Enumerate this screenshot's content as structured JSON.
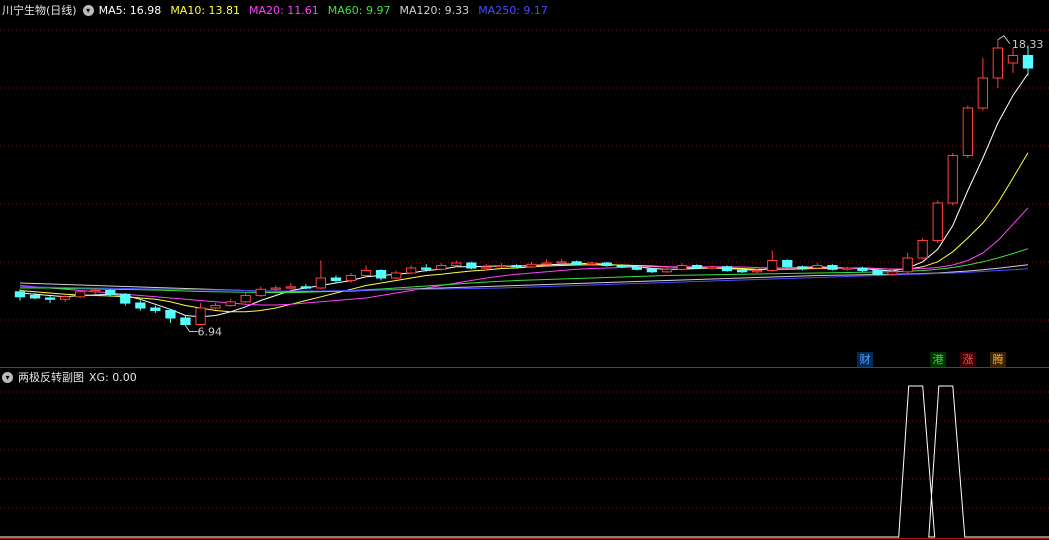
{
  "header": {
    "stock_title": "川宁生物(日线)",
    "ma_items": [
      {
        "label": "MA5: 16.98",
        "color": "#ffffff"
      },
      {
        "label": "MA10: 13.81",
        "color": "#ffff40"
      },
      {
        "label": "MA20: 11.61",
        "color": "#ff40ff"
      },
      {
        "label": "MA60: 9.97",
        "color": "#40e040"
      },
      {
        "label": "MA120: 9.33",
        "color": "#d0d0d0"
      },
      {
        "label": "MA250: 9.17",
        "color": "#4a4aff"
      }
    ]
  },
  "sub_header": {
    "title": "两极反转副图",
    "xg_label": "XG: 0.00"
  },
  "badges": [
    {
      "text": "财",
      "color": "#5aa0ff",
      "bg": "#002a55"
    },
    {
      "text": "港",
      "color": "#30e030",
      "bg": "#003300"
    },
    {
      "text": "涨",
      "color": "#ff5050",
      "bg": "#3a0000"
    },
    {
      "text": "腾",
      "color": "#ffaa30",
      "bg": "#3a2200"
    }
  ],
  "colors": {
    "up": "#ff4040",
    "down": "#54ffff",
    "grid": "#8a1010",
    "divider": "#b01818"
  },
  "chart_data": {
    "type": "candlestick",
    "price_range": [
      6.0,
      19.2
    ],
    "annotations": {
      "high_label": "18.33",
      "low_label": "6.94"
    },
    "candles": [
      {
        "o": 8.25,
        "c": 8.05,
        "h": 8.35,
        "l": 7.9
      },
      {
        "o": 8.1,
        "c": 8.0,
        "h": 8.2,
        "l": 7.95
      },
      {
        "o": 8.0,
        "c": 7.95,
        "h": 8.1,
        "l": 7.8
      },
      {
        "o": 7.95,
        "c": 8.05,
        "h": 8.1,
        "l": 7.85
      },
      {
        "o": 8.05,
        "c": 8.25,
        "h": 8.3,
        "l": 8.0
      },
      {
        "o": 8.25,
        "c": 8.3,
        "h": 8.4,
        "l": 8.15
      },
      {
        "o": 8.3,
        "c": 8.15,
        "h": 8.35,
        "l": 8.05
      },
      {
        "o": 8.15,
        "c": 7.8,
        "h": 8.2,
        "l": 7.7
      },
      {
        "o": 7.8,
        "c": 7.6,
        "h": 7.9,
        "l": 7.5
      },
      {
        "o": 7.6,
        "c": 7.5,
        "h": 7.7,
        "l": 7.4
      },
      {
        "o": 7.5,
        "c": 7.2,
        "h": 7.55,
        "l": 7.0
      },
      {
        "o": 7.2,
        "c": 6.94,
        "h": 7.3,
        "l": 6.9
      },
      {
        "o": 6.94,
        "c": 7.6,
        "h": 7.8,
        "l": 6.94
      },
      {
        "o": 7.6,
        "c": 7.7,
        "h": 7.8,
        "l": 7.55
      },
      {
        "o": 7.7,
        "c": 7.85,
        "h": 7.95,
        "l": 7.65
      },
      {
        "o": 7.85,
        "c": 8.1,
        "h": 8.2,
        "l": 7.8
      },
      {
        "o": 8.1,
        "c": 8.35,
        "h": 8.45,
        "l": 8.05
      },
      {
        "o": 8.35,
        "c": 8.4,
        "h": 8.5,
        "l": 8.3
      },
      {
        "o": 8.4,
        "c": 8.45,
        "h": 8.6,
        "l": 8.35
      },
      {
        "o": 8.45,
        "c": 8.4,
        "h": 8.55,
        "l": 8.35
      },
      {
        "o": 8.4,
        "c": 8.8,
        "h": 9.5,
        "l": 8.35
      },
      {
        "o": 8.8,
        "c": 8.7,
        "h": 8.9,
        "l": 8.6
      },
      {
        "o": 8.7,
        "c": 8.9,
        "h": 9.0,
        "l": 8.6
      },
      {
        "o": 8.9,
        "c": 9.1,
        "h": 9.3,
        "l": 8.85
      },
      {
        "o": 9.1,
        "c": 8.8,
        "h": 9.15,
        "l": 8.7
      },
      {
        "o": 8.8,
        "c": 9.0,
        "h": 9.1,
        "l": 8.75
      },
      {
        "o": 9.0,
        "c": 9.2,
        "h": 9.3,
        "l": 8.95
      },
      {
        "o": 9.2,
        "c": 9.15,
        "h": 9.35,
        "l": 9.05
      },
      {
        "o": 9.15,
        "c": 9.3,
        "h": 9.4,
        "l": 9.1
      },
      {
        "o": 9.3,
        "c": 9.4,
        "h": 9.5,
        "l": 9.25
      },
      {
        "o": 9.4,
        "c": 9.2,
        "h": 9.45,
        "l": 9.15
      },
      {
        "o": 9.2,
        "c": 9.25,
        "h": 9.35,
        "l": 9.1
      },
      {
        "o": 9.25,
        "c": 9.3,
        "h": 9.4,
        "l": 9.2
      },
      {
        "o": 9.3,
        "c": 9.25,
        "h": 9.35,
        "l": 9.2
      },
      {
        "o": 9.25,
        "c": 9.35,
        "h": 9.45,
        "l": 9.2
      },
      {
        "o": 9.35,
        "c": 9.4,
        "h": 9.55,
        "l": 9.3
      },
      {
        "o": 9.4,
        "c": 9.45,
        "h": 9.55,
        "l": 9.35
      },
      {
        "o": 9.45,
        "c": 9.35,
        "h": 9.5,
        "l": 9.3
      },
      {
        "o": 9.35,
        "c": 9.4,
        "h": 9.45,
        "l": 9.3
      },
      {
        "o": 9.4,
        "c": 9.3,
        "h": 9.45,
        "l": 9.25
      },
      {
        "o": 9.3,
        "c": 9.25,
        "h": 9.35,
        "l": 9.2
      },
      {
        "o": 9.25,
        "c": 9.15,
        "h": 9.3,
        "l": 9.1
      },
      {
        "o": 9.15,
        "c": 9.05,
        "h": 9.2,
        "l": 9.0
      },
      {
        "o": 9.05,
        "c": 9.15,
        "h": 9.25,
        "l": 9.0
      },
      {
        "o": 9.15,
        "c": 9.3,
        "h": 9.4,
        "l": 9.1
      },
      {
        "o": 9.3,
        "c": 9.2,
        "h": 9.35,
        "l": 9.15
      },
      {
        "o": 9.2,
        "c": 9.25,
        "h": 9.3,
        "l": 9.15
      },
      {
        "o": 9.25,
        "c": 9.1,
        "h": 9.3,
        "l": 9.05
      },
      {
        "o": 9.1,
        "c": 9.05,
        "h": 9.15,
        "l": 9.0
      },
      {
        "o": 9.05,
        "c": 9.1,
        "h": 9.15,
        "l": 9.0
      },
      {
        "o": 9.1,
        "c": 9.5,
        "h": 9.9,
        "l": 9.05
      },
      {
        "o": 9.5,
        "c": 9.25,
        "h": 9.55,
        "l": 9.2
      },
      {
        "o": 9.25,
        "c": 9.2,
        "h": 9.3,
        "l": 9.1
      },
      {
        "o": 9.2,
        "c": 9.3,
        "h": 9.4,
        "l": 9.15
      },
      {
        "o": 9.3,
        "c": 9.15,
        "h": 9.35,
        "l": 9.1
      },
      {
        "o": 9.15,
        "c": 9.2,
        "h": 9.25,
        "l": 9.1
      },
      {
        "o": 9.2,
        "c": 9.1,
        "h": 9.25,
        "l": 9.05
      },
      {
        "o": 9.1,
        "c": 8.95,
        "h": 9.15,
        "l": 8.9
      },
      {
        "o": 8.95,
        "c": 9.05,
        "h": 9.1,
        "l": 8.9
      },
      {
        "o": 9.05,
        "c": 9.6,
        "h": 9.8,
        "l": 9.0
      },
      {
        "o": 9.6,
        "c": 10.3,
        "h": 10.4,
        "l": 9.55
      },
      {
        "o": 10.3,
        "c": 11.8,
        "h": 11.9,
        "l": 10.2
      },
      {
        "o": 11.8,
        "c": 13.7,
        "h": 13.8,
        "l": 11.7
      },
      {
        "o": 13.7,
        "c": 15.6,
        "h": 15.7,
        "l": 13.6
      },
      {
        "o": 15.6,
        "c": 16.8,
        "h": 17.6,
        "l": 15.5
      },
      {
        "o": 16.8,
        "c": 18.0,
        "h": 18.33,
        "l": 16.4
      },
      {
        "o": 17.4,
        "c": 17.7,
        "h": 18.0,
        "l": 17.0
      },
      {
        "o": 17.7,
        "c": 17.2,
        "h": 18.1,
        "l": 16.9
      }
    ],
    "moving_averages": [
      {
        "name": "MA5",
        "color": "#ffffff",
        "values": [
          8.2,
          8.15,
          8.1,
          8.05,
          8.1,
          8.12,
          8.15,
          8.1,
          7.95,
          7.75,
          7.55,
          7.3,
          7.25,
          7.3,
          7.45,
          7.65,
          7.9,
          8.1,
          8.3,
          8.4,
          8.5,
          8.6,
          8.7,
          8.85,
          8.9,
          8.95,
          9.0,
          9.1,
          9.15,
          9.25,
          9.25,
          9.27,
          9.28,
          9.27,
          9.3,
          9.33,
          9.35,
          9.37,
          9.38,
          9.35,
          9.3,
          9.25,
          9.18,
          9.15,
          9.15,
          9.18,
          9.2,
          9.18,
          9.15,
          9.1,
          9.2,
          9.2,
          9.22,
          9.25,
          9.22,
          9.2,
          9.18,
          9.12,
          9.08,
          9.2,
          9.45,
          9.95,
          10.9,
          12.3,
          13.6,
          15.0,
          16.1,
          16.98
        ]
      },
      {
        "name": "MA10",
        "color": "#ffff40",
        "values": [
          8.3,
          8.25,
          8.2,
          8.15,
          8.12,
          8.1,
          8.08,
          8.05,
          8.0,
          7.95,
          7.85,
          7.7,
          7.6,
          7.5,
          7.45,
          7.45,
          7.5,
          7.6,
          7.75,
          7.9,
          8.05,
          8.2,
          8.35,
          8.5,
          8.6,
          8.7,
          8.8,
          8.9,
          8.95,
          9.02,
          9.08,
          9.12,
          9.18,
          9.2,
          9.25,
          9.28,
          9.3,
          9.32,
          9.33,
          9.32,
          9.32,
          9.3,
          9.28,
          9.25,
          9.22,
          9.2,
          9.2,
          9.2,
          9.18,
          9.15,
          9.15,
          9.15,
          9.16,
          9.18,
          9.18,
          9.2,
          9.2,
          9.18,
          9.15,
          9.15,
          9.25,
          9.45,
          9.85,
          10.4,
          11.0,
          11.8,
          12.8,
          13.81
        ]
      },
      {
        "name": "MA20",
        "color": "#ff40ff",
        "values": [
          8.5,
          8.45,
          8.4,
          8.35,
          8.3,
          8.25,
          8.2,
          8.15,
          8.1,
          8.05,
          8.0,
          7.95,
          7.9,
          7.85,
          7.8,
          7.75,
          7.72,
          7.72,
          7.75,
          7.8,
          7.85,
          7.9,
          7.95,
          8.0,
          8.1,
          8.2,
          8.3,
          8.4,
          8.5,
          8.6,
          8.7,
          8.8,
          8.88,
          8.95,
          9.0,
          9.05,
          9.1,
          9.15,
          9.18,
          9.2,
          9.22,
          9.24,
          9.25,
          9.25,
          9.25,
          9.25,
          9.25,
          9.25,
          9.24,
          9.22,
          9.2,
          9.2,
          9.2,
          9.2,
          9.2,
          9.19,
          9.18,
          9.17,
          9.16,
          9.16,
          9.18,
          9.22,
          9.32,
          9.5,
          9.8,
          10.3,
          10.95,
          11.61
        ]
      },
      {
        "name": "MA60",
        "color": "#40e040",
        "values": [
          8.4,
          8.4,
          8.4,
          8.38,
          8.37,
          8.36,
          8.35,
          8.34,
          8.33,
          8.32,
          8.3,
          8.28,
          8.26,
          8.25,
          8.24,
          8.23,
          8.22,
          8.22,
          8.22,
          8.23,
          8.25,
          8.27,
          8.3,
          8.33,
          8.36,
          8.4,
          8.44,
          8.48,
          8.52,
          8.56,
          8.6,
          8.64,
          8.67,
          8.7,
          8.72,
          8.74,
          8.76,
          8.78,
          8.8,
          8.82,
          8.84,
          8.86,
          8.88,
          8.9,
          8.91,
          8.92,
          8.93,
          8.94,
          8.95,
          8.96,
          8.97,
          8.98,
          8.99,
          9.0,
          9.01,
          9.02,
          9.03,
          9.04,
          9.05,
          9.07,
          9.1,
          9.15,
          9.22,
          9.32,
          9.45,
          9.6,
          9.78,
          9.97
        ]
      },
      {
        "name": "MA120",
        "color": "#d0d0d0",
        "values": [
          8.6,
          8.58,
          8.56,
          8.54,
          8.52,
          8.5,
          8.48,
          8.46,
          8.44,
          8.42,
          8.4,
          8.38,
          8.36,
          8.34,
          8.32,
          8.3,
          8.28,
          8.27,
          8.26,
          8.26,
          8.26,
          8.27,
          8.28,
          8.3,
          8.32,
          8.34,
          8.36,
          8.38,
          8.4,
          8.42,
          8.44,
          8.46,
          8.48,
          8.5,
          8.52,
          8.54,
          8.56,
          8.58,
          8.6,
          8.62,
          8.64,
          8.66,
          8.68,
          8.7,
          8.72,
          8.74,
          8.76,
          8.78,
          8.8,
          8.82,
          8.84,
          8.86,
          8.88,
          8.9,
          8.91,
          8.92,
          8.93,
          8.94,
          8.95,
          8.96,
          8.98,
          9.0,
          9.04,
          9.08,
          9.13,
          9.19,
          9.26,
          9.33
        ]
      },
      {
        "name": "MA250",
        "color": "#4a4aff",
        "values": [
          8.45,
          8.44,
          8.43,
          8.42,
          8.41,
          8.4,
          8.39,
          8.38,
          8.37,
          8.36,
          8.35,
          8.34,
          8.33,
          8.32,
          8.31,
          8.3,
          8.29,
          8.28,
          8.28,
          8.28,
          8.28,
          8.29,
          8.3,
          8.31,
          8.32,
          8.33,
          8.34,
          8.35,
          8.36,
          8.37,
          8.38,
          8.39,
          8.4,
          8.42,
          8.44,
          8.46,
          8.48,
          8.5,
          8.52,
          8.54,
          8.56,
          8.58,
          8.6,
          8.62,
          8.64,
          8.66,
          8.68,
          8.7,
          8.72,
          8.74,
          8.76,
          8.78,
          8.8,
          8.82,
          8.84,
          8.86,
          8.88,
          8.9,
          8.92,
          8.94,
          8.96,
          8.98,
          9.0,
          9.03,
          9.06,
          9.1,
          9.13,
          9.17
        ]
      }
    ],
    "xg_signal": {
      "name": "XG",
      "range": [
        0,
        1
      ],
      "values": [
        0,
        0,
        0,
        0,
        0,
        0,
        0,
        0,
        0,
        0,
        0,
        0,
        0,
        0,
        0,
        0,
        0,
        0,
        0,
        0,
        0,
        0,
        0,
        0,
        0,
        0,
        0,
        0,
        0,
        0,
        0,
        0,
        0,
        0,
        0,
        0,
        0,
        0,
        0,
        0,
        0,
        0,
        0,
        0,
        0,
        0,
        0,
        0,
        0,
        0,
        0,
        0,
        0,
        0,
        0,
        0,
        0,
        0,
        0,
        0,
        1,
        0,
        1,
        0,
        0,
        0,
        0,
        0
      ]
    }
  }
}
